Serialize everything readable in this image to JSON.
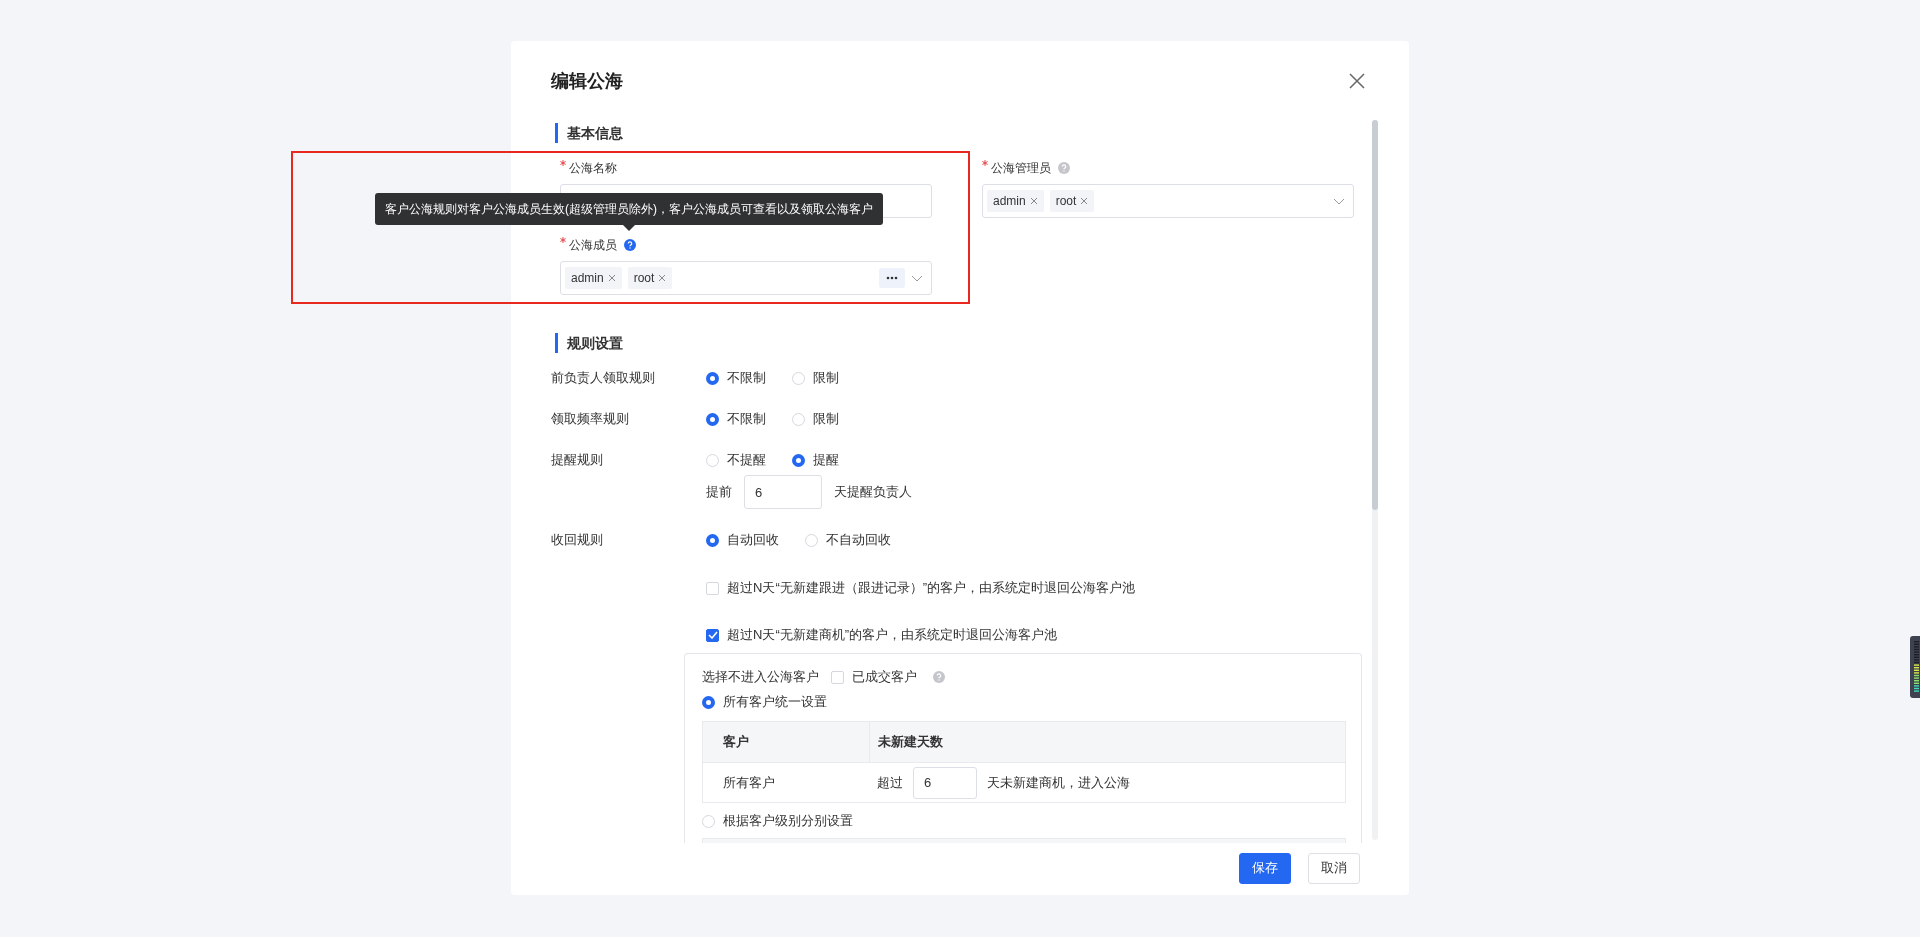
{
  "dialog": {
    "title": "编辑公海"
  },
  "basic_info": {
    "heading": "基本信息",
    "highlighted": true,
    "fields": [
      {
        "kind": "text",
        "label": "公海名称",
        "required": true
      },
      {
        "kind": "tags",
        "label": "公海管理员",
        "required": true,
        "help": true,
        "help_active": false,
        "tags": [
          "admin",
          "root"
        ]
      },
      {
        "kind": "tags",
        "label": "公海成员",
        "required": true,
        "help": true,
        "help_active": true,
        "tags": [
          "admin",
          "root"
        ],
        "more": true
      }
    ],
    "tooltip": "客户公海规则对客户公海成员生效(超级管理员除外)，客户公海成员可查看以及领取公海客户"
  },
  "rules": {
    "heading": "规则设置",
    "rows": [
      {
        "label": "前负责人领取规则",
        "options": [
          {
            "label": "不限制",
            "selected": true
          },
          {
            "label": "限制",
            "selected": false
          }
        ]
      },
      {
        "label": "领取频率规则",
        "options": [
          {
            "label": "不限制",
            "selected": true
          },
          {
            "label": "限制",
            "selected": false
          }
        ]
      },
      {
        "label": "提醒规则",
        "options": [
          {
            "label": "不提醒",
            "selected": false
          },
          {
            "label": "提醒",
            "selected": true
          }
        ],
        "sub": {
          "prefix": "提前",
          "value": "6",
          "suffix": "天提醒负责人"
        }
      },
      {
        "label": "收回规则",
        "options": [
          {
            "label": "自动回收",
            "selected": true
          },
          {
            "label": "不自动回收",
            "selected": false
          }
        ]
      }
    ],
    "conditions": [
      {
        "label": "超过N天“无新建跟进（跟进记录）”的客户，由系统定时退回公海客户池",
        "checked": false
      },
      {
        "label": "超过N天“无新建商机”的客户，由系统定时退回公海客户池",
        "checked": true
      }
    ],
    "panel": {
      "exclude_label": "选择不进入公海客户",
      "exclude_option": {
        "label": "已成交客户",
        "checked": false
      },
      "modes": [
        {
          "label": "所有客户统一设置",
          "selected": true,
          "table": {
            "columns": [
              "客户",
              "未新建天数"
            ],
            "rows": [
              {
                "customer": "所有客户",
                "prefix": "超过",
                "value": "6",
                "suffix": "天未新建商机，进入公海"
              }
            ]
          }
        },
        {
          "label": "根据客户级别分别设置",
          "selected": false
        }
      ]
    }
  },
  "footer": {
    "buttons": [
      {
        "label": "保存",
        "kind": "primary"
      },
      {
        "label": "取消",
        "kind": "default"
      }
    ]
  }
}
